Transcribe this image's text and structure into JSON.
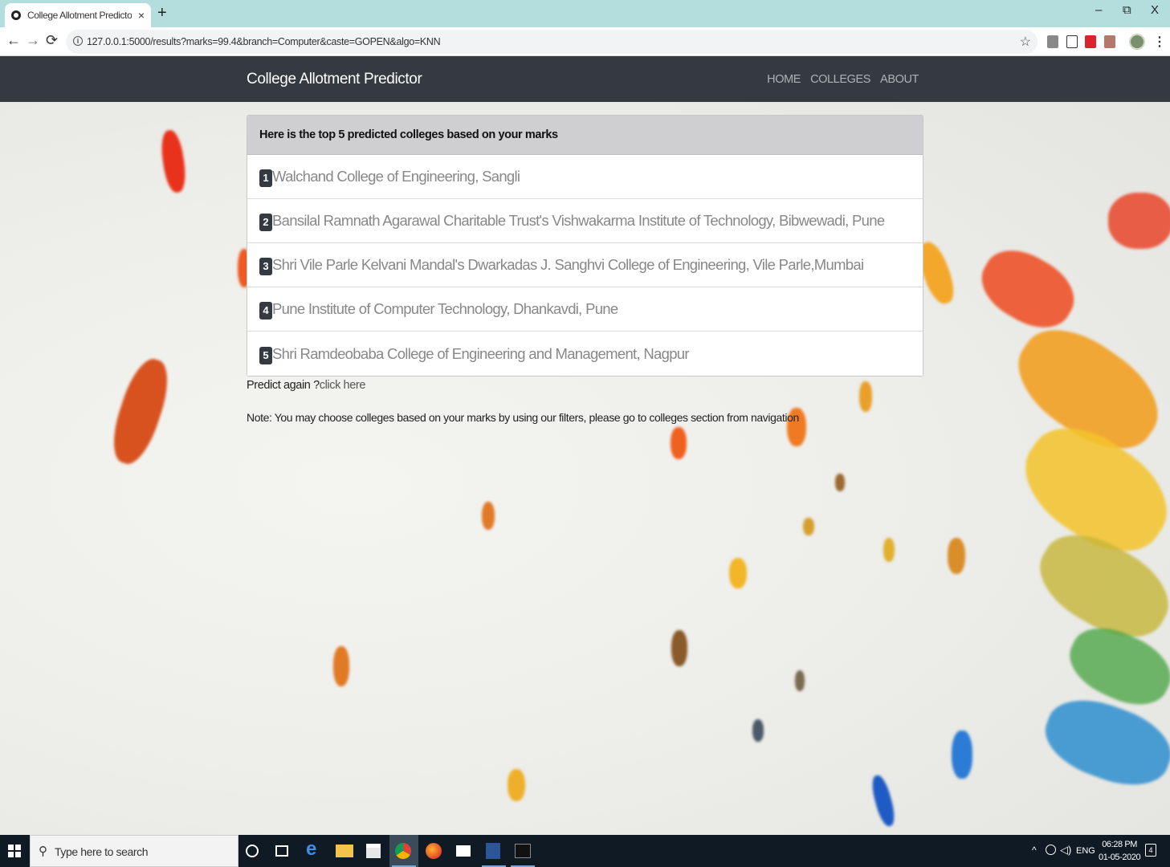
{
  "browser": {
    "tab_title": "College Allotment Predictor usin",
    "tab_close": "×",
    "new_tab": "+",
    "url": "127.0.0.1:5000/results?marks=99.4&branch=Computer&caste=GOPEN&algo=KNN",
    "window_controls": {
      "minimize": "–",
      "restore": "⧉",
      "close": "X"
    },
    "nav": {
      "back": "←",
      "forward": "→",
      "reload": "⟳"
    },
    "star": "☆",
    "kebab": "⋮"
  },
  "site": {
    "brand": "College Allotment Predictor",
    "nav_links": [
      "HOME",
      "COLLEGES",
      "ABOUT"
    ]
  },
  "results": {
    "header": "Here is the top 5 predicted colleges based on your marks",
    "items": [
      {
        "rank": "1",
        "name": "Walchand College of Engineering, Sangli"
      },
      {
        "rank": "2",
        "name": "Bansilal Ramnath Agarawal Charitable Trust's Vishwakarma Institute of Technology, Bibwewadi, Pune"
      },
      {
        "rank": "3",
        "name": "Shri Vile Parle Kelvani Mandal's Dwarkadas J. Sanghvi College of Engineering, Vile Parle,Mumbai"
      },
      {
        "rank": "4",
        "name": "Pune Institute of Computer Technology, Dhankavdi, Pune"
      },
      {
        "rank": "5",
        "name": "Shri Ramdeobaba College of Engineering and Management, Nagpur"
      }
    ],
    "predict_again_prefix": "Predict again ?",
    "predict_again_link": "click here",
    "note": "Note: You may choose colleges based on your marks by using our filters, please go to colleges section from navigation"
  },
  "taskbar": {
    "search_placeholder": "Type here to search",
    "tray_chevron": "^",
    "language": "ENG",
    "time": "06:28 PM",
    "date": "01-05-2020",
    "notification_count": "4"
  },
  "colors": {
    "navbar": "#343a40",
    "card_header": "#cfcfd1",
    "badge": "#343a40",
    "tabstrip": "#b3dedd"
  }
}
